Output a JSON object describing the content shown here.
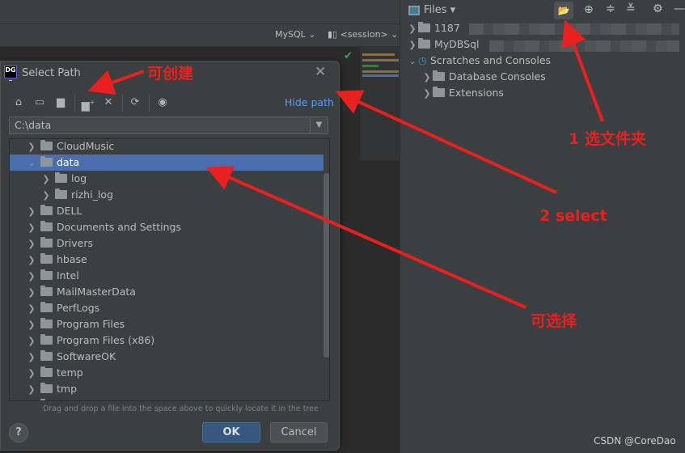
{
  "editor": {
    "dialect": "MySQL",
    "session": "<session>"
  },
  "files_panel": {
    "title": "Files",
    "items": [
      {
        "label": "1187",
        "expanded": false,
        "level": 0
      },
      {
        "label": "MyDBSql",
        "expanded": false,
        "level": 0
      },
      {
        "label": "Scratches and Consoles",
        "expanded": true,
        "level": 0
      },
      {
        "label": "Database Consoles",
        "expanded": false,
        "level": 1
      },
      {
        "label": "Extensions",
        "expanded": false,
        "level": 1
      }
    ],
    "toolbar_icons": [
      "open-folder-icon",
      "locate-icon",
      "expand-all-icon",
      "collapse-all-icon",
      "gear-icon",
      "minimize-icon"
    ]
  },
  "dialog": {
    "title": "Select Path",
    "logo": "DG",
    "hide_path": "Hide path",
    "path_value": "C:\\data",
    "toolbar_icons": [
      "home-icon",
      "desktop-icon",
      "project-folder-icon",
      "new-folder-icon",
      "delete-icon",
      "refresh-icon",
      "show-hidden-icon"
    ],
    "tree": [
      {
        "label": "CloudMusic",
        "level": 0,
        "expanded": false
      },
      {
        "label": "data",
        "level": 0,
        "expanded": true,
        "selected": true
      },
      {
        "label": "log",
        "level": 1,
        "expanded": false
      },
      {
        "label": "rizhi_log",
        "level": 1,
        "expanded": false
      },
      {
        "label": "DELL",
        "level": 0,
        "expanded": false
      },
      {
        "label": "Documents and Settings",
        "level": 0,
        "expanded": false
      },
      {
        "label": "Drivers",
        "level": 0,
        "expanded": false
      },
      {
        "label": "hbase",
        "level": 0,
        "expanded": false
      },
      {
        "label": "Intel",
        "level": 0,
        "expanded": false
      },
      {
        "label": "MailMasterData",
        "level": 0,
        "expanded": false
      },
      {
        "label": "PerfLogs",
        "level": 0,
        "expanded": false
      },
      {
        "label": "Program Files",
        "level": 0,
        "expanded": false
      },
      {
        "label": "Program Files (x86)",
        "level": 0,
        "expanded": false
      },
      {
        "label": "SoftwareOK",
        "level": 0,
        "expanded": false
      },
      {
        "label": "temp",
        "level": 0,
        "expanded": false
      },
      {
        "label": "tmp",
        "level": 0,
        "expanded": false
      },
      {
        "label": "Users",
        "level": 0,
        "expanded": false
      }
    ],
    "hint": "Drag and drop a file into the space above to quickly locate it in the tree",
    "ok": "OK",
    "cancel": "Cancel",
    "help": "?"
  },
  "annotations": {
    "create": "可创建",
    "select_folder": "1 选文件夹",
    "select": "2 select",
    "selectable": "可选择",
    "color": "#e8201f"
  },
  "watermark": "CSDN @CoreDao"
}
